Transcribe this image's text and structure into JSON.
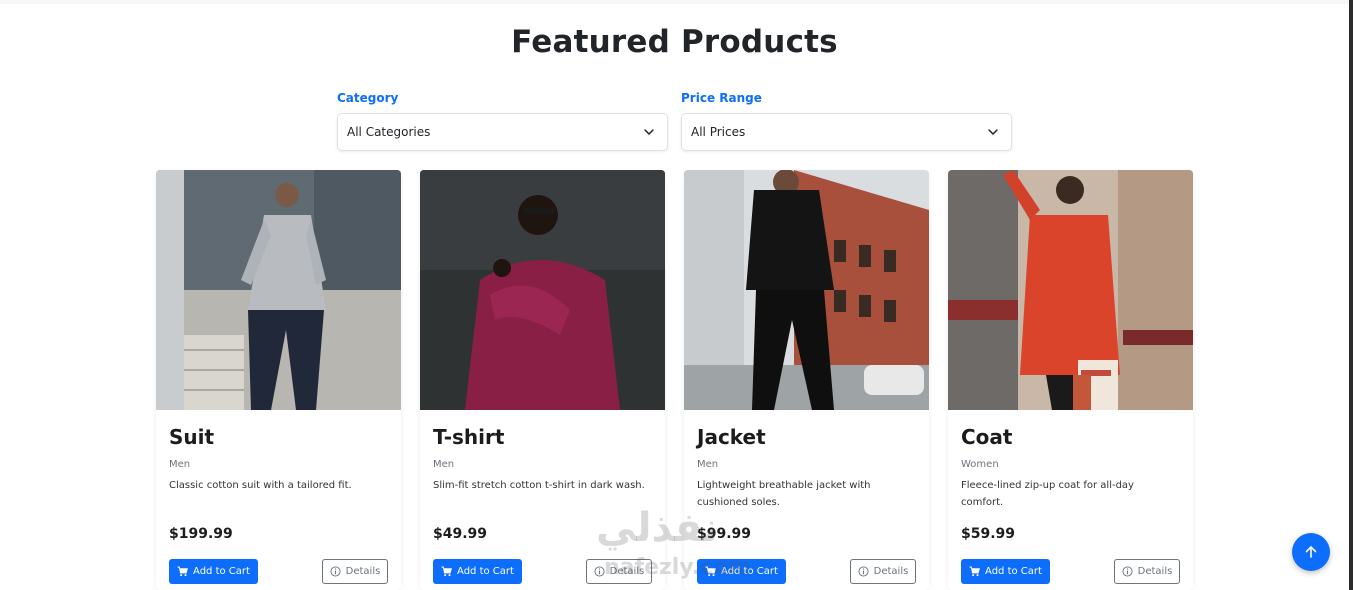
{
  "page": {
    "title": "Featured Products"
  },
  "filters": {
    "category": {
      "label": "Category",
      "value": "All Categories"
    },
    "price": {
      "label": "Price Range",
      "value": "All Prices"
    }
  },
  "products": [
    {
      "name": "Suit",
      "category": "Men",
      "description": "Classic cotton suit with a tailored fit.",
      "price": "$199.99",
      "add_label": "Add to Cart",
      "details_label": "Details"
    },
    {
      "name": "T-shirt",
      "category": "Men",
      "description": "Slim-fit stretch cotton t-shirt in dark wash.",
      "price": "$49.99",
      "add_label": "Add to Cart",
      "details_label": "Details"
    },
    {
      "name": "Jacket",
      "category": "Men",
      "description": "Lightweight breathable jacket with cushioned soles.",
      "price": "$99.99",
      "add_label": "Add to Cart",
      "details_label": "Details"
    },
    {
      "name": "Coat",
      "category": "Women",
      "description": "Fleece-lined zip-up coat for all-day comfort.",
      "price": "$59.99",
      "add_label": "Add to Cart",
      "details_label": "Details"
    }
  ],
  "watermark": {
    "arabic": "نفذلي",
    "latin": "nafezly.com"
  },
  "colors": {
    "primary": "#0d6efd",
    "secondary": "#6c757d",
    "heading": "#212529"
  },
  "icons": {
    "cart": "cart-icon",
    "info": "info-icon",
    "chevron": "chevron-down-icon",
    "scroll_top": "arrow-up-icon"
  }
}
